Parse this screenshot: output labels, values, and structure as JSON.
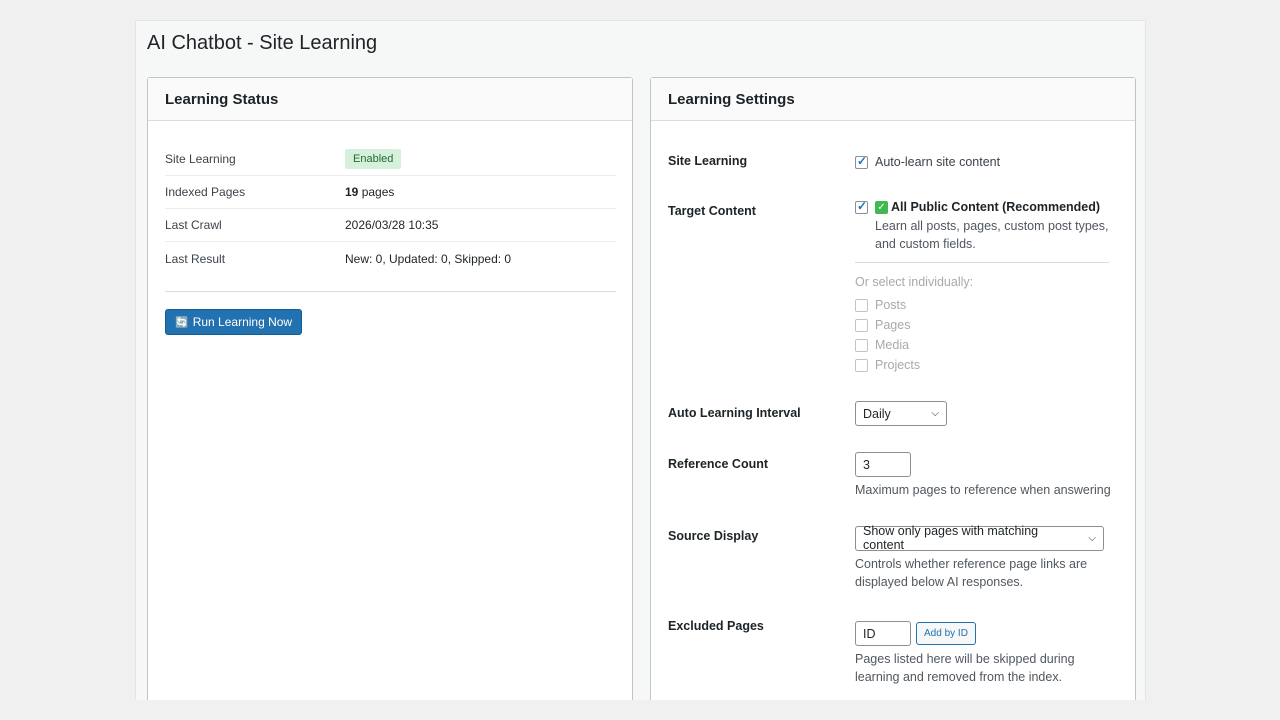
{
  "page": {
    "title": "AI Chatbot - Site Learning"
  },
  "status": {
    "header": "Learning Status",
    "rows": [
      {
        "label": "Site Learning",
        "value": "Enabled"
      },
      {
        "label": "Indexed Pages",
        "count": "19",
        "unit": "pages"
      },
      {
        "label": "Last Crawl",
        "value": "2026/03/28 10:35"
      },
      {
        "label": "Last Result",
        "value": "New: 0, Updated: 0, Skipped: 0"
      }
    ],
    "run_button": "Run Learning Now",
    "run_icon": "refresh-icon"
  },
  "settings": {
    "header": "Learning Settings",
    "site_learning": {
      "label": "Site Learning",
      "checkbox": "Auto-learn site content",
      "checked": true
    },
    "target_content": {
      "label": "Target Content",
      "all_option": "All Public Content (Recommended)",
      "all_checked": true,
      "all_desc_1": "Learn all posts, pages, custom post types,",
      "all_desc_2": "and custom fields.",
      "or_select": "Or select individually:",
      "items": [
        "Posts",
        "Pages",
        "Media",
        "Projects"
      ]
    },
    "interval": {
      "label": "Auto Learning Interval",
      "selected": "Daily"
    },
    "reference_count": {
      "label": "Reference Count",
      "value": "3",
      "help": "Maximum pages to reference when answering"
    },
    "source_display": {
      "label": "Source Display",
      "selected": "Show only pages with matching content",
      "help_1": "Controls whether reference page links are",
      "help_2": "displayed below AI responses."
    },
    "excluded_pages": {
      "label": "Excluded Pages",
      "placeholder": "ID",
      "add_button": "Add by ID",
      "help_1": "Pages listed here will be skipped during",
      "help_2": "learning and removed from the index."
    }
  },
  "colors": {
    "primary": "#2271b1",
    "badge_bg": "#d7f0dc",
    "badge_text": "#1f6b33"
  }
}
